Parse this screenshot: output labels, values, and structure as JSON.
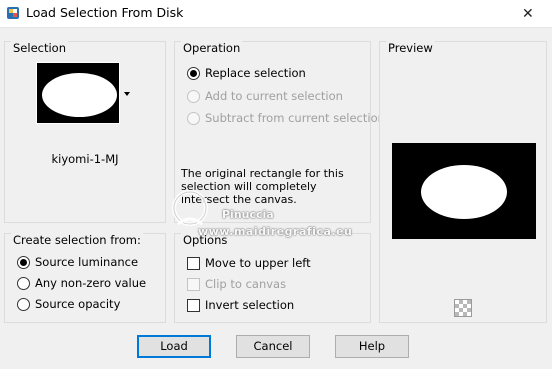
{
  "window": {
    "title": "Load Selection From Disk",
    "close_symbol": "✕"
  },
  "selection_group": {
    "title": "Selection",
    "selected_name": "kiyomi-1-MJ"
  },
  "operation_group": {
    "title": "Operation",
    "options": [
      {
        "label": "Replace selection",
        "checked": true,
        "disabled": false
      },
      {
        "label": "Add to current selection",
        "checked": false,
        "disabled": true
      },
      {
        "label": "Subtract from current selection",
        "checked": false,
        "disabled": true
      }
    ],
    "info": "The original rectangle for this selection will completely intersect the canvas."
  },
  "preview_group": {
    "title": "Preview"
  },
  "create_group": {
    "title": "Create selection from:",
    "options": [
      {
        "label": "Source luminance",
        "checked": true
      },
      {
        "label": "Any non-zero value",
        "checked": false
      },
      {
        "label": "Source opacity",
        "checked": false
      }
    ]
  },
  "options_group": {
    "title": "Options",
    "items": [
      {
        "label": "Move to upper left",
        "checked": false,
        "disabled": false
      },
      {
        "label": "Clip to canvas",
        "checked": false,
        "disabled": true
      },
      {
        "label": "Invert selection",
        "checked": false,
        "disabled": false
      }
    ]
  },
  "buttons": {
    "load": "Load",
    "cancel": "Cancel",
    "help": "Help"
  },
  "watermark": {
    "line1": "Pinuccia",
    "line2": "www.maidiregrafica.eu"
  },
  "icons": {
    "app": "psp-app-icon",
    "preview_transparency": "checkerboard-icon",
    "dropdown": "dropdown-arrow-icon"
  }
}
